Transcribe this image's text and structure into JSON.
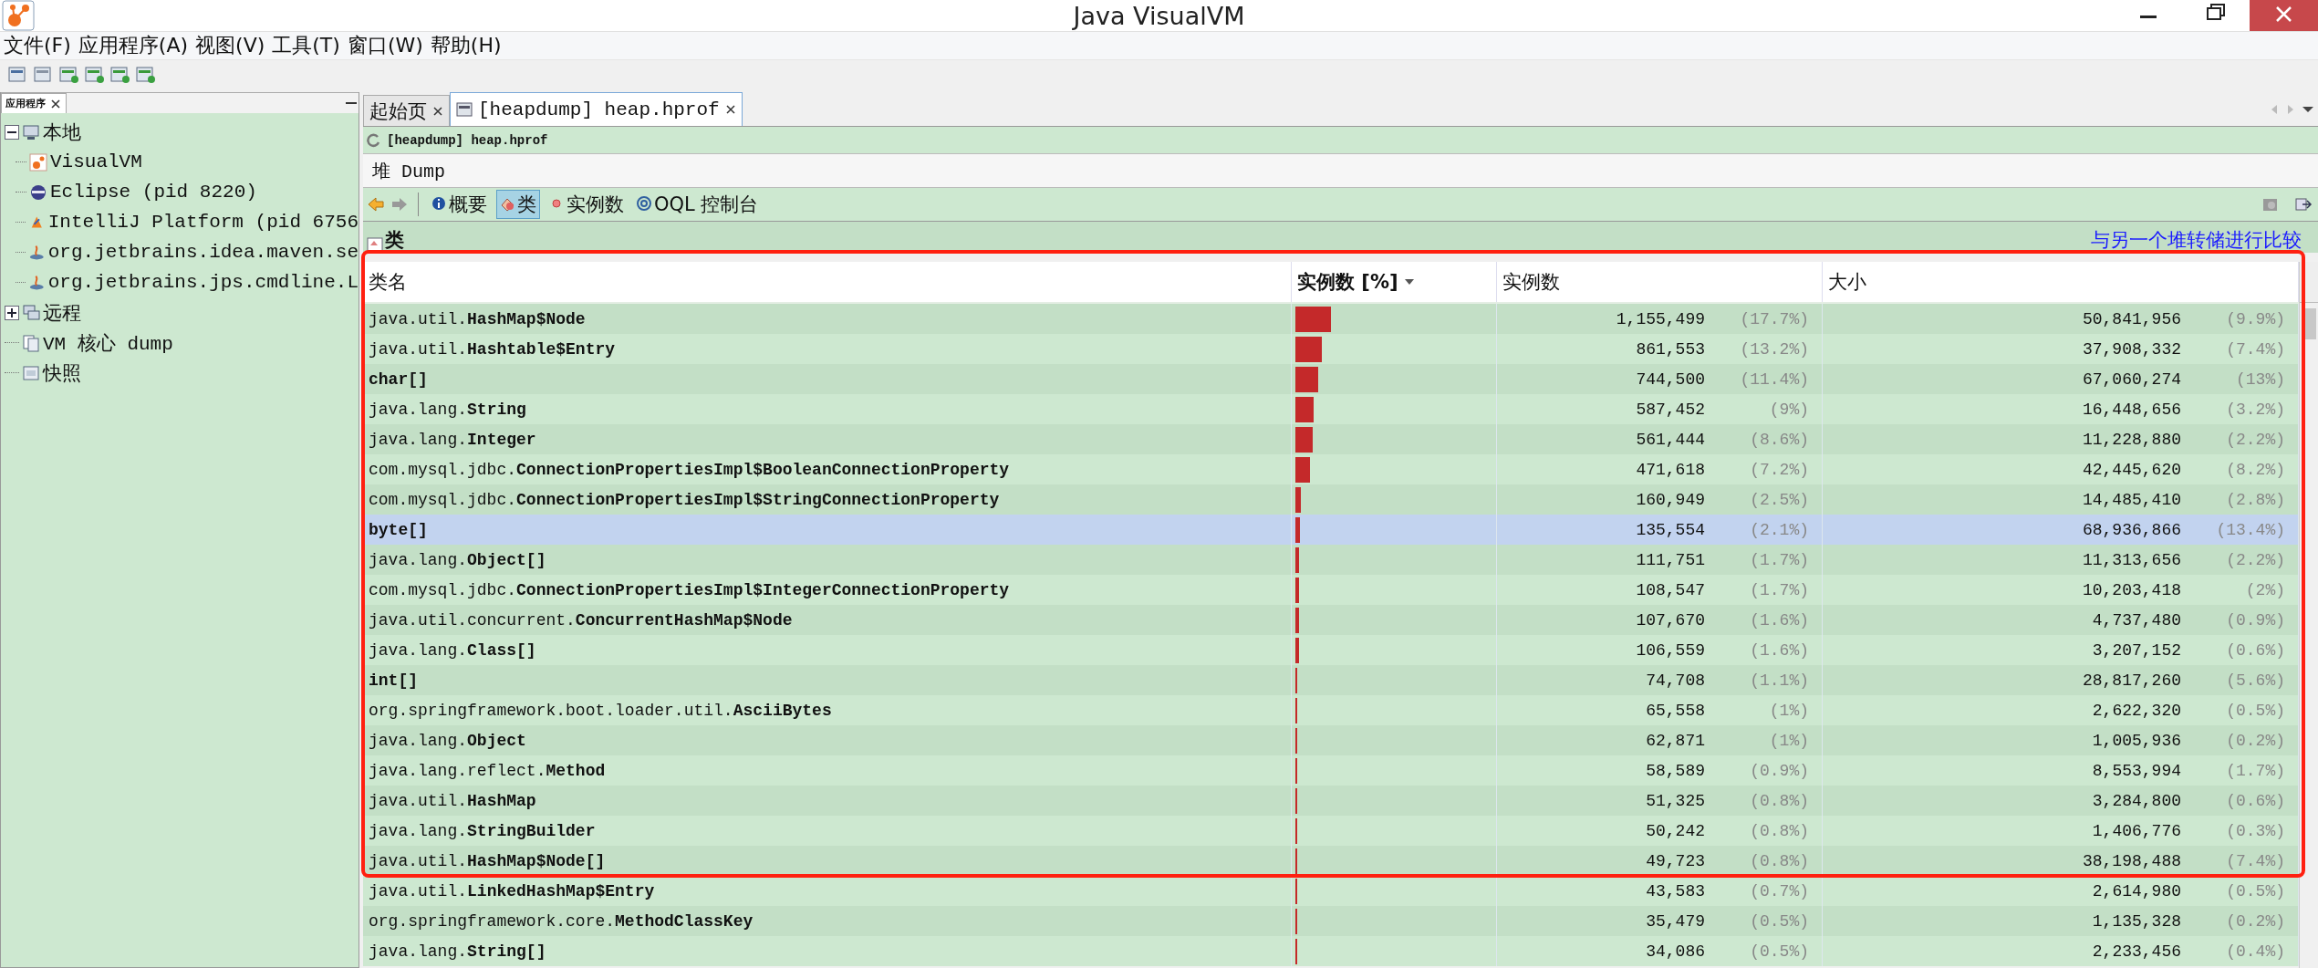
{
  "window": {
    "title": "Java VisualVM"
  },
  "menu": [
    "文件(F)",
    "应用程序(A)",
    "视图(V)",
    "工具(T)",
    "窗口(W)",
    "帮助(H)"
  ],
  "sidebar": {
    "tab": "应用程序",
    "tree": [
      {
        "label": "本地",
        "expanded": true,
        "children": [
          {
            "label": "VisualVM"
          },
          {
            "label": "Eclipse (pid 8220)"
          },
          {
            "label": "IntelliJ Platform (pid 6756"
          },
          {
            "label": "org.jetbrains.idea.maven.se"
          },
          {
            "label": "org.jetbrains.jps.cmdline.L"
          }
        ]
      },
      {
        "label": "远程",
        "expanded": false
      },
      {
        "label": "VM 核心 dump"
      },
      {
        "label": "快照"
      }
    ]
  },
  "tabs": [
    {
      "label": "起始页",
      "selected": false
    },
    {
      "label": "[heapdump] heap.hprof",
      "selected": true
    }
  ],
  "document": {
    "subtitle": "[heapdump] heap.hprof",
    "heading": "堆 Dump",
    "views": [
      {
        "label": "概要",
        "selected": false
      },
      {
        "label": "类",
        "selected": true
      },
      {
        "label": "实例数",
        "selected": false
      },
      {
        "label": "OQL 控制台",
        "selected": false
      }
    ],
    "section": "类",
    "compare_link": "与另一个堆转储进行比较"
  },
  "table": {
    "columns": [
      {
        "label": "类名",
        "sorted": false
      },
      {
        "label": "实例数 [%]",
        "sorted": true
      },
      {
        "label": "实例数",
        "sorted": false
      },
      {
        "label": "大小",
        "sorted": false
      }
    ],
    "rows": [
      {
        "name": "java.util.**HashMap$Node**",
        "level": 0.177,
        "count": "1,155,499",
        "count_pct": "(17.7%)",
        "size": "50,841,956",
        "size_pct": "(9.9%)",
        "selected": false
      },
      {
        "name": "java.util.**Hashtable$Entry**",
        "level": 0.132,
        "count": "861,553",
        "count_pct": "(13.2%)",
        "size": "37,908,332",
        "size_pct": "(7.4%)",
        "selected": false
      },
      {
        "name": "**char[]**",
        "level": 0.114,
        "count": "744,500",
        "count_pct": "(11.4%)",
        "size": "67,060,274",
        "size_pct": "(13%)",
        "selected": false
      },
      {
        "name": "java.lang.**String**",
        "level": 0.09,
        "count": "587,452",
        "count_pct": "(9%)",
        "size": "16,448,656",
        "size_pct": "(3.2%)",
        "selected": false
      },
      {
        "name": "java.lang.**Integer**",
        "level": 0.086,
        "count": "561,444",
        "count_pct": "(8.6%)",
        "size": "11,228,880",
        "size_pct": "(2.2%)",
        "selected": false
      },
      {
        "name": "com.mysql.jdbc.**ConnectionPropertiesImpl$BooleanConnectionProperty**",
        "level": 0.072,
        "count": "471,618",
        "count_pct": "(7.2%)",
        "size": "42,445,620",
        "size_pct": "(8.2%)",
        "selected": false
      },
      {
        "name": "com.mysql.jdbc.**ConnectionPropertiesImpl$StringConnectionProperty**",
        "level": 0.025,
        "count": "160,949",
        "count_pct": "(2.5%)",
        "size": "14,485,410",
        "size_pct": "(2.8%)",
        "selected": false
      },
      {
        "name": "**byte[]**",
        "level": 0.021,
        "count": "135,554",
        "count_pct": "(2.1%)",
        "size": "68,936,866",
        "size_pct": "(13.4%)",
        "selected": true
      },
      {
        "name": "java.lang.**Object[]**",
        "level": 0.017,
        "count": "111,751",
        "count_pct": "(1.7%)",
        "size": "11,313,656",
        "size_pct": "(2.2%)",
        "selected": false
      },
      {
        "name": "com.mysql.jdbc.**ConnectionPropertiesImpl$IntegerConnectionProperty**",
        "level": 0.017,
        "count": "108,547",
        "count_pct": "(1.7%)",
        "size": "10,203,418",
        "size_pct": "(2%)",
        "selected": false
      },
      {
        "name": "java.util.concurrent.**ConcurrentHashMap$Node**",
        "level": 0.016,
        "count": "107,670",
        "count_pct": "(1.6%)",
        "size": "4,737,480",
        "size_pct": "(0.9%)",
        "selected": false
      },
      {
        "name": "java.lang.**Class[]**",
        "level": 0.016,
        "count": "106,559",
        "count_pct": "(1.6%)",
        "size": "3,207,152",
        "size_pct": "(0.6%)",
        "selected": false
      },
      {
        "name": "**int[]**",
        "level": 0.011,
        "count": "74,708",
        "count_pct": "(1.1%)",
        "size": "28,817,260",
        "size_pct": "(5.6%)",
        "selected": false
      },
      {
        "name": "org.springframework.boot.loader.util.**AsciiBytes**",
        "level": 0.01,
        "count": "65,558",
        "count_pct": "(1%)",
        "size": "2,622,320",
        "size_pct": "(0.5%)",
        "selected": false
      },
      {
        "name": "java.lang.**Object**",
        "level": 0.01,
        "count": "62,871",
        "count_pct": "(1%)",
        "size": "1,005,936",
        "size_pct": "(0.2%)",
        "selected": false
      },
      {
        "name": "java.lang.reflect.**Method**",
        "level": 0.009,
        "count": "58,589",
        "count_pct": "(0.9%)",
        "size": "8,553,994",
        "size_pct": "(1.7%)",
        "selected": false
      },
      {
        "name": "java.util.**HashMap**",
        "level": 0.008,
        "count": "51,325",
        "count_pct": "(0.8%)",
        "size": "3,284,800",
        "size_pct": "(0.6%)",
        "selected": false
      },
      {
        "name": "java.lang.**StringBuilder**",
        "level": 0.008,
        "count": "50,242",
        "count_pct": "(0.8%)",
        "size": "1,406,776",
        "size_pct": "(0.3%)",
        "selected": false
      },
      {
        "name": "java.util.**HashMap$Node[]**",
        "level": 0.008,
        "count": "49,723",
        "count_pct": "(0.8%)",
        "size": "38,198,488",
        "size_pct": "(7.4%)",
        "selected": false
      },
      {
        "name": "java.util.**LinkedHashMap$Entry**",
        "level": 0.007,
        "count": "43,583",
        "count_pct": "(0.7%)",
        "size": "2,614,980",
        "size_pct": "(0.5%)",
        "selected": false
      },
      {
        "name": "org.springframework.core.**MethodClassKey**",
        "level": 0.005,
        "count": "35,479",
        "count_pct": "(0.5%)",
        "size": "1,135,328",
        "size_pct": "(0.2%)",
        "selected": false
      },
      {
        "name": "java.lang.**String[]**",
        "level": 0.005,
        "count": "34,086",
        "count_pct": "(0.5%)",
        "size": "2,233,456",
        "size_pct": "(0.4%)",
        "selected": false
      }
    ]
  }
}
